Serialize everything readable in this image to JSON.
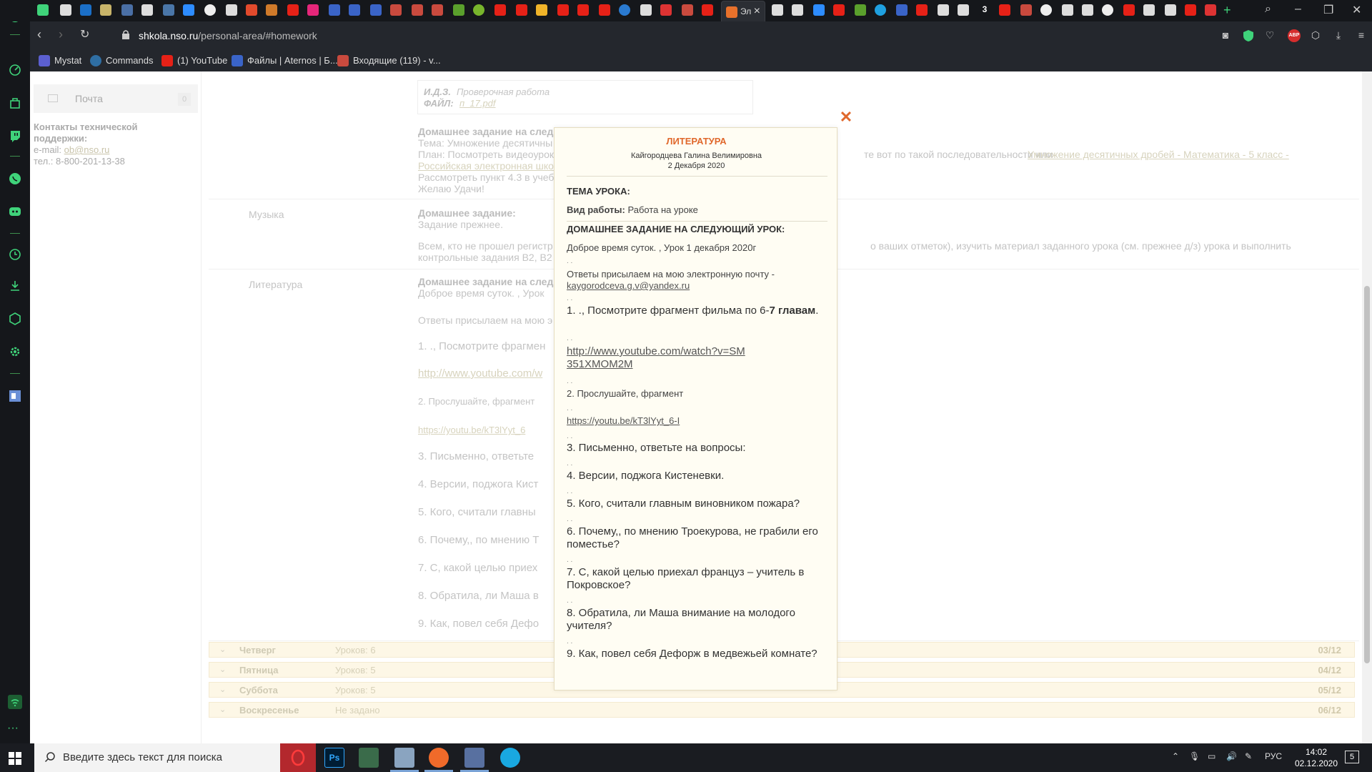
{
  "browser": {
    "active_tab_label": "Эл",
    "url_domain": "shkola.nso.ru",
    "url_path": "/personal-area/#homework",
    "bookmarks": [
      "Mystat",
      "Commands",
      "(1) YouTube",
      "Файлы | Aternos | Б...",
      "Входящие (119) - v..."
    ],
    "extension_abp": "ABP"
  },
  "left_panel": {
    "mail_label": "Почта",
    "mail_count": "0",
    "support_title": "Контакты технической поддержки:",
    "email_prefix": "e-mail: ",
    "email_link": "ob@nso.ru",
    "phone": "тел.: 8-800-201-13-38"
  },
  "background": {
    "idz_label": "И.Д.З.",
    "idz_value": "Проверочная работа",
    "file_label": "ФАЙЛ:",
    "file_value": "п_17.pdf",
    "math_heading": "Домашнее задание на след",
    "math_theme": "Тема: Умножение десятичны",
    "math_plan": "План: Посмотреть видеоурок",
    "math_plan_tail": "те вот по такой последовательности или",
    "math_link_tail": "Умножение десятичных дробей - Математика - 5 класс -",
    "math_link2": "Российская электронная шко",
    "math_read": "Рассмотреть пункт 4.3 в учеб",
    "math_wish": "Желаю Удачи!",
    "music_subject": "Музыка",
    "music_heading": "Домашнее задание:",
    "music_text": "Задание прежнее.",
    "music_long": "Всем, кто не прошел регистр",
    "music_long_tail": "о ваших отметок), изучить материал заданного урока (см. прежнее д/з) урока и выполнить",
    "music_long2": "контрольные задания В2, В2",
    "lit_subject": "Литература",
    "lit_heading": "Домашнее задание на след",
    "lit_greet": "Доброе время суток.  , Урок",
    "lit_lines": [
      "Ответы присылаем на мою э",
      "1.    ., Посмотрите фрагмен",
      "http://www.youtube.com/w",
      "2.   Прослушайте, фрагмент",
      "https://youtu.be/kT3lYyt_6",
      "3.   Письменно, ответьте",
      "4.   Версии, поджога Кист",
      "5.   Кого, считали главны",
      "6.   Почему,, по мнению Т",
      "7.   С, какой целью приех",
      "8.   Обратила, ли Маша в",
      "9.   Как, повел себя Дефо"
    ],
    "days": [
      {
        "name": "Четверг",
        "lessons": "Уроков: 6",
        "date": "03/12"
      },
      {
        "name": "Пятница",
        "lessons": "Уроков: 5",
        "date": "04/12"
      },
      {
        "name": "Суббота",
        "lessons": "Уроков: 5",
        "date": "05/12"
      },
      {
        "name": "Воскресенье",
        "lessons": "Не задано",
        "date": "06/12"
      }
    ]
  },
  "modal": {
    "subject": "ЛИТЕРАТУРА",
    "teacher": "Кайгородцева Галина Велимировна",
    "date": "2 Декабря 2020",
    "topic_label": "ТЕМА УРОКА:",
    "work_type_label": "Вид работы:",
    "work_type_value": "Работа на уроке",
    "homework_label": "ДОМАШНЕЕ ЗАДАНИЕ НА СЛЕДУЮЩИЙ УРОК:",
    "greeting": "Доброе время суток.  , Урок 1 декабря  2020г",
    "answers_text": "Ответы присылаем на мою электронную почту -",
    "email": "kaygorodceva.g.v@yandex.ru",
    "dots": ". .",
    "task1_prefix": "1.    ., Посмотрите фрагмент фильма по  6-",
    "task1_bold": "7 главам",
    "task1_suffix": ".",
    "link1": "http://www.youtube.com/watch?v=SM351XMOM2M",
    "task2": "2.    Прослушайте, фрагмент",
    "link2": "https://youtu.be/kT3lYyt_6-I",
    "task3": "3.    Письменно, ответьте на вопросы:",
    "task4": "4.    Версии, поджога Кистеневки.",
    "task5": "5.    Кого, считали главным виновником пожара?",
    "task6": "6.    Почему,, по мнению Троекурова, не грабили его поместье?",
    "task7": "7.    С, какой целью приехал француз – учитель в Покровское?",
    "task8": "8.    Обратила, ли Маша внимание на молодого учителя?",
    "task9": "9.    Как, повел себя Дефорж в медвежьей комнате?",
    "close_glyph": "✕"
  },
  "taskbar": {
    "search_placeholder": "Введите здесь текст для поиска",
    "lang": "РУС",
    "time": "14:02",
    "date": "02.12.2020",
    "notifications": "5"
  },
  "colors": {
    "accent_orange": "#e0682c",
    "modal_bg": "#fffdf3",
    "chrome_dark": "#24272d",
    "sidebar_dark": "#15171b"
  }
}
